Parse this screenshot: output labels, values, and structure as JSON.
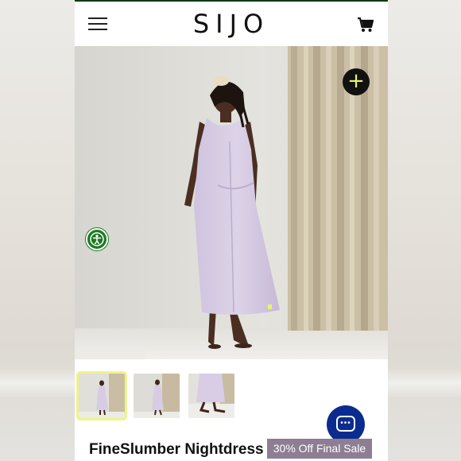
{
  "header": {
    "brand": "SIJO",
    "menu_icon": "hamburger-menu-icon",
    "cart_icon": "shopping-cart-icon"
  },
  "hero": {
    "zoom_icon": "plus-icon",
    "accessibility_icon": "accessibility-person-icon"
  },
  "thumbnails": [
    {
      "active": true
    },
    {
      "active": false
    },
    {
      "active": false
    }
  ],
  "chat": {
    "icon": "chat-bubble-icon"
  },
  "product": {
    "title": "FineSlumber Nightdress",
    "sale_badge": "30% Off Final Sale"
  },
  "colors": {
    "brand_dark": "#0e3b17",
    "accent_lime": "#e6f56a",
    "accessibility_green": "#1c7a23",
    "chat_blue": "#0b2c8f",
    "badge_purple": "#8d7e93"
  }
}
